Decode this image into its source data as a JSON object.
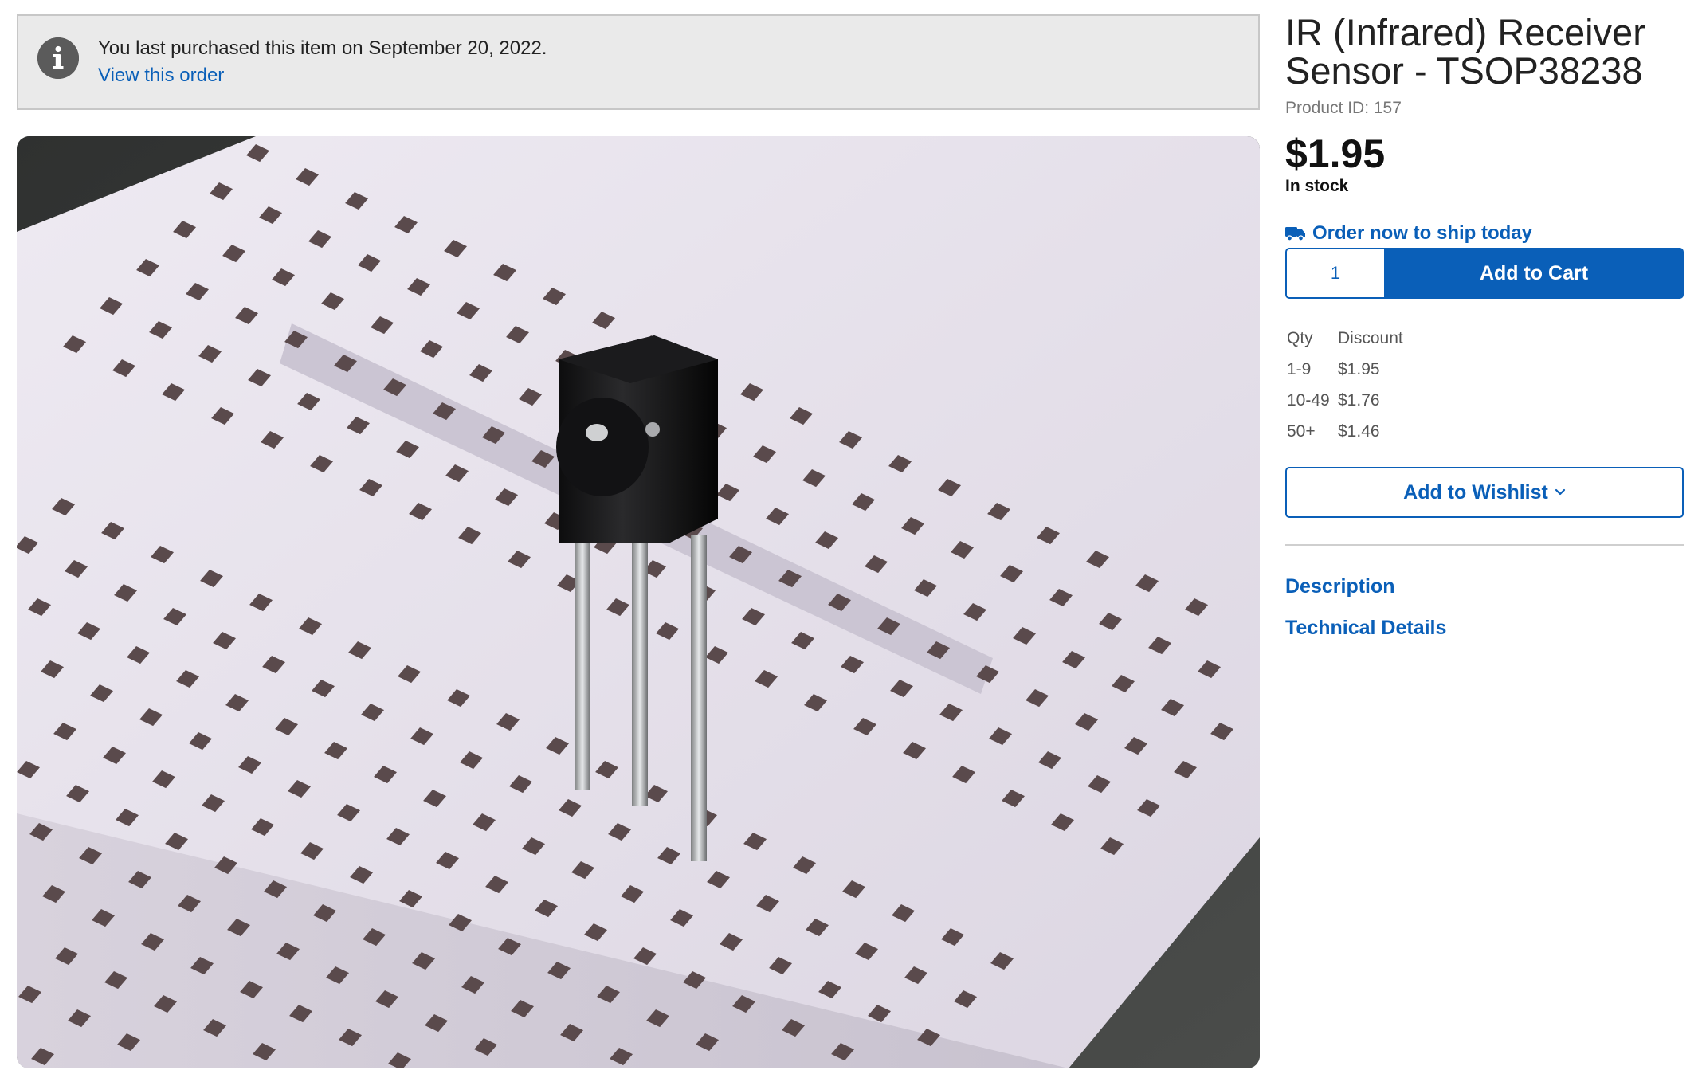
{
  "notice": {
    "message": "You last purchased this item on September 20, 2022.",
    "link_label": "View this order",
    "icon": "info-icon"
  },
  "product": {
    "title": "IR (Infrared) Receiver Sensor - TSOP38238",
    "product_id": "Product ID: 157",
    "price": "$1.95",
    "stock": "In stock",
    "image_alt": "IR receiver sensor on a mini breadboard"
  },
  "shipping": {
    "label": "Order now to ship today",
    "icon": "truck-icon"
  },
  "cart": {
    "quantity": "1",
    "add_label": "Add to Cart"
  },
  "discounts": {
    "headers": [
      "Qty",
      "Discount"
    ],
    "rows": [
      {
        "qty": "1-9",
        "price": "$1.95"
      },
      {
        "qty": "10-49",
        "price": "$1.76"
      },
      {
        "qty": "50+",
        "price": "$1.46"
      }
    ]
  },
  "wishlist": {
    "label": "Add to Wishlist",
    "icon": "chevron-down-icon"
  },
  "sections": {
    "description": "Description",
    "technical": "Technical Details"
  },
  "colors": {
    "accent": "#0a5fb8",
    "notice_bg": "#eaeaea"
  }
}
